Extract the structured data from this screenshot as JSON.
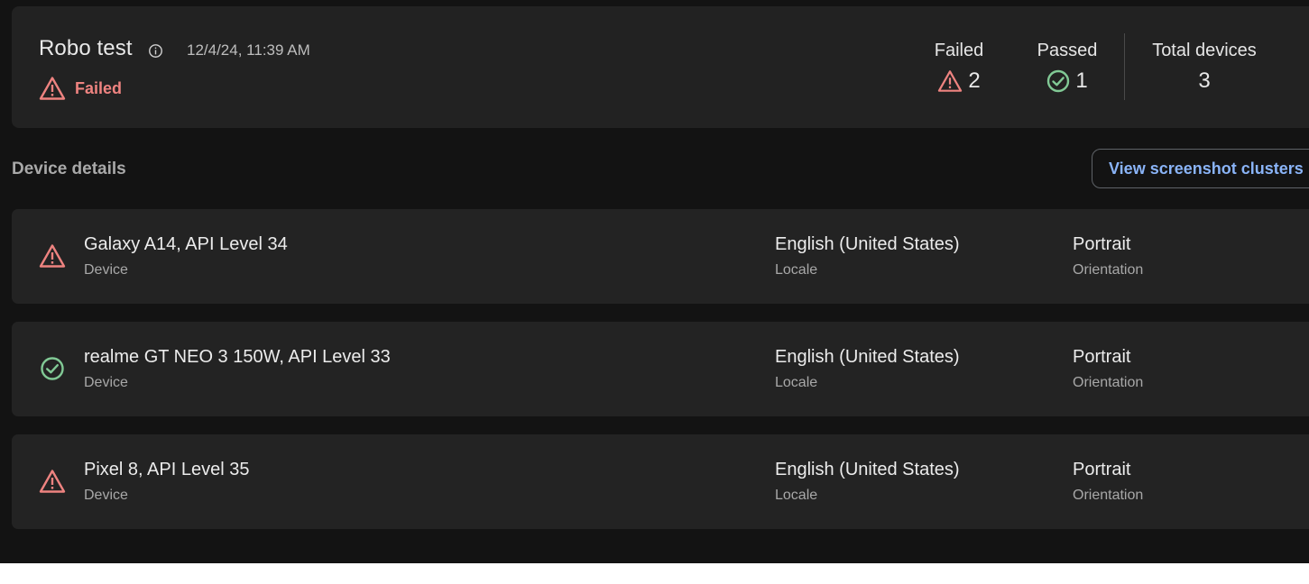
{
  "summary": {
    "title": "Robo test",
    "timestamp": "12/4/24, 11:39 AM",
    "status": "Failed",
    "stats": {
      "failed_label": "Failed",
      "failed_value": "2",
      "passed_label": "Passed",
      "passed_value": "1",
      "total_label": "Total devices",
      "total_value": "3"
    }
  },
  "device_details": {
    "title": "Device details",
    "clusters_button_label": "View screenshot clusters",
    "devices": [
      {
        "name": "Galaxy A14, API Level 34",
        "name_label": "Device",
        "locale": "English (United States)",
        "locale_label": "Locale",
        "orientation": "Portrait",
        "orientation_label": "Orientation",
        "status_icon": "warning-icon"
      },
      {
        "name": "realme GT NEO 3 150W, API Level 33",
        "name_label": "Device",
        "locale": "English (United States)",
        "locale_label": "Locale",
        "orientation": "Portrait",
        "orientation_label": "Orientation",
        "status_icon": "check-circle-icon"
      },
      {
        "name": "Pixel 8, API Level 35",
        "name_label": "Device",
        "locale": "English (United States)",
        "locale_label": "Locale",
        "orientation": "Portrait",
        "orientation_label": "Orientation",
        "status_icon": "warning-icon"
      }
    ]
  },
  "colors": {
    "background": "#131313",
    "card": "#232323",
    "failed": "#ee8380",
    "passed": "#81c995",
    "link": "#8ab4f8"
  }
}
